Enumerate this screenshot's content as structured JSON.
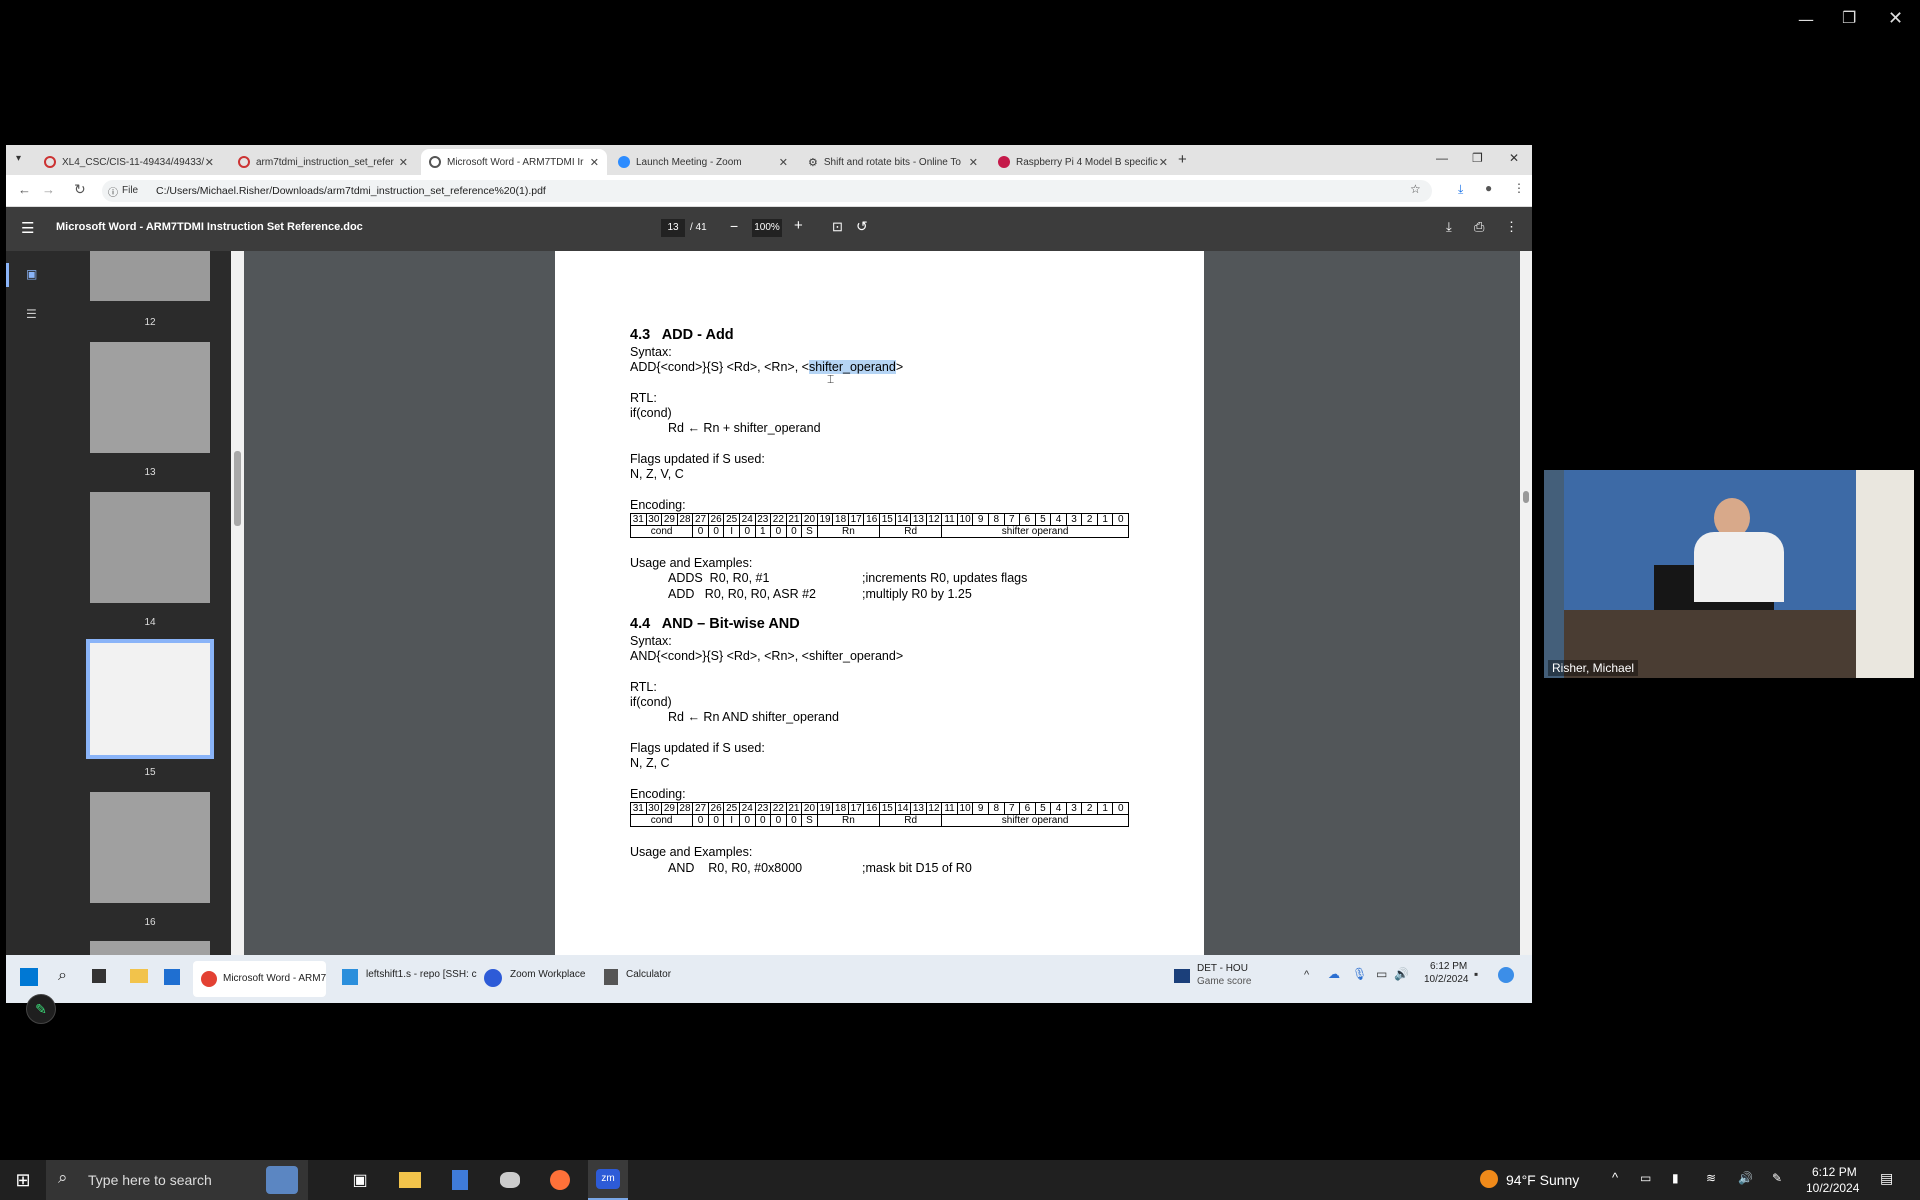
{
  "tabs": [
    {
      "label": "XL4_CSC/CIS-11-49434/49433/"
    },
    {
      "label": "arm7tdmi_instruction_set_refer"
    },
    {
      "label": "Microsoft Word - ARM7TDMI Ir"
    },
    {
      "label": "Launch Meeting - Zoom"
    },
    {
      "label": "Shift and rotate bits - Online To"
    },
    {
      "label": "Raspberry Pi 4 Model B specific"
    }
  ],
  "address": {
    "scheme": "File",
    "url": "C:/Users/Michael.Risher/Downloads/arm7tdmi_instruction_set_reference%20(1).pdf"
  },
  "pdf": {
    "title": "Microsoft Word - ARM7TDMI Instruction Set Reference.doc",
    "page": "13",
    "total": "/ 41",
    "zoom": "100%"
  },
  "thumbs": [
    {
      "label": "12"
    },
    {
      "label": "13"
    },
    {
      "label": "14"
    },
    {
      "label": "15"
    },
    {
      "label": "16"
    }
  ],
  "doc": {
    "h1": "4.3   ADD - Add",
    "syntax_label": "Syntax:",
    "add_syntax_a": "ADD{<cond>}{S} <Rd>, <Rn>, <",
    "add_syntax_sel": "shifter_operand",
    "add_syntax_b": ">",
    "rtl_label": "RTL:",
    "if_cond": "if(cond)",
    "add_rtl": "Rd ← Rn + shifter_operand",
    "flags_label": "Flags updated if S used:",
    "add_flags": "N, Z, V, C",
    "enc_label": "Encoding:",
    "usage_label": "Usage and Examples:",
    "add_ex1_code": "ADDS  R0, R0, #1",
    "add_ex1_cmt": ";increments R0, updates flags",
    "add_ex2_code": "ADD   R0, R0, R0, ASR #2",
    "add_ex2_cmt": ";multiply R0 by 1.25",
    "h2": "4.4   AND – Bit-wise AND",
    "and_syntax": "AND{<cond>}{S} <Rd>, <Rn>, <shifter_operand>",
    "and_rtl": "Rd ← Rn AND shifter_operand",
    "and_flags": "N, Z, C",
    "and_ex1_code": "AND    R0, R0, #0x8000",
    "and_ex1_cmt": ";mask bit D15 of R0",
    "bits": [
      "31",
      "30",
      "29",
      "28",
      "27",
      "26",
      "25",
      "24",
      "23",
      "22",
      "21",
      "20",
      "19",
      "18",
      "17",
      "16",
      "15",
      "14",
      "13",
      "12",
      "11",
      "10",
      "9",
      "8",
      "7",
      "6",
      "5",
      "4",
      "3",
      "2",
      "1",
      "0"
    ],
    "add_enc": [
      "cond",
      "0",
      "0",
      "I",
      "0",
      "1",
      "0",
      "0",
      "S",
      "Rn",
      "Rd",
      "shifter operand"
    ],
    "and_enc": [
      "cond",
      "0",
      "0",
      "I",
      "0",
      "0",
      "0",
      "0",
      "S",
      "Rn",
      "Rd",
      "shifter operand"
    ]
  },
  "inner_taskbar": {
    "chrome": "Microsoft Word - ARM7",
    "vscode": "leftshift1.s - repo [SSH: c",
    "zoom": "Zoom Workplace",
    "calc": "Calculator",
    "sports_a": "DET - HOU",
    "sports_b": "Game score",
    "time": "6:12 PM",
    "date": "10/2/2024"
  },
  "camera": {
    "name": "Risher, Michael"
  },
  "taskbar": {
    "search": "Type here to search",
    "weather": "94°F  Sunny",
    "time": "6:12 PM",
    "date": "10/2/2024"
  }
}
